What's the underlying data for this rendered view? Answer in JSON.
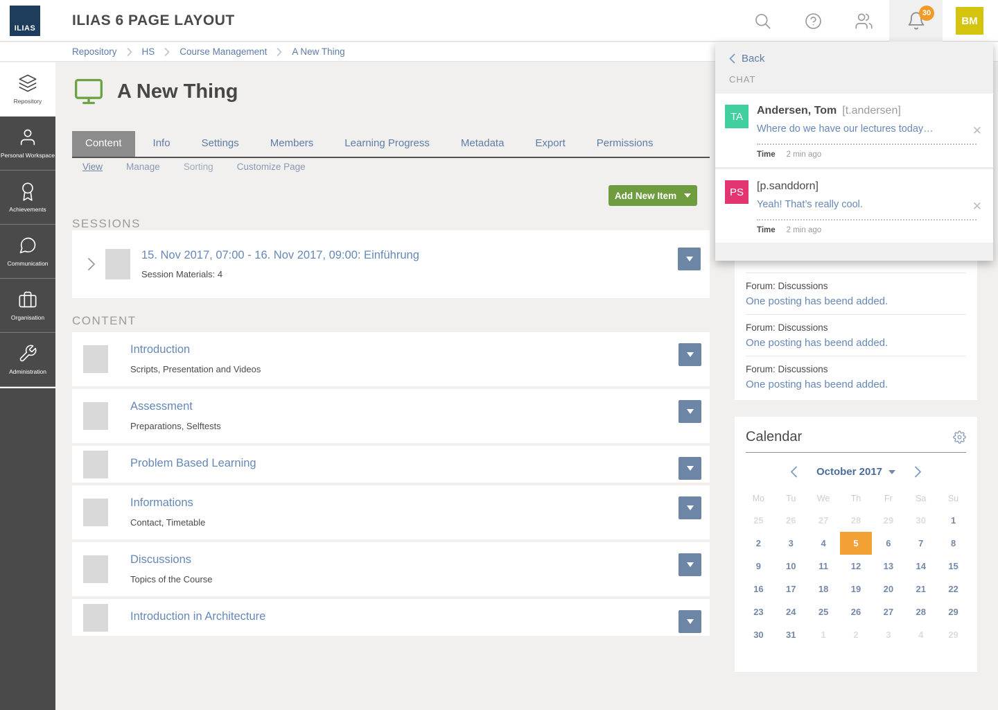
{
  "header": {
    "logo_text": "ILIAS",
    "title": "ILIAS 6 PAGE LAYOUT",
    "notification_count": "30",
    "avatar_initials": "BM"
  },
  "breadcrumb": {
    "items": [
      {
        "label": "Repository"
      },
      {
        "label": "HS"
      },
      {
        "label": "Course Management"
      },
      {
        "label": "A New Thing"
      }
    ]
  },
  "sidebar": {
    "items": [
      {
        "label": "Repository"
      },
      {
        "label": "Personal Workspace"
      },
      {
        "label": "Achievements"
      },
      {
        "label": "Communication"
      },
      {
        "label": "Organisation"
      },
      {
        "label": "Administration"
      }
    ]
  },
  "page": {
    "title": "A New Thing",
    "tabs": [
      {
        "label": "Content",
        "state": "active"
      },
      {
        "label": "Info",
        "state": ""
      },
      {
        "label": "Settings",
        "state": ""
      },
      {
        "label": "Members",
        "state": ""
      },
      {
        "label": "Learning Progress",
        "state": ""
      },
      {
        "label": "Metadata",
        "state": ""
      },
      {
        "label": "Export",
        "state": ""
      },
      {
        "label": "Permissions",
        "state": ""
      }
    ],
    "subtabs": [
      {
        "label": "View",
        "state": "active"
      },
      {
        "label": "Manage",
        "state": ""
      },
      {
        "label": "Sorting",
        "state": "muted"
      },
      {
        "label": "Customize Page",
        "state": ""
      }
    ],
    "add_button_label": "Add New Item"
  },
  "sessions": {
    "heading": "SESSIONS",
    "items": [
      {
        "title": "15. Nov 2017, 07:00 - 16. Nov 2017, 09:00: Einführung",
        "materials": "Session Materials: 4"
      }
    ]
  },
  "content": {
    "heading": "CONTENT",
    "items": [
      {
        "title": "Introduction",
        "description": "Scripts, Presentation and Videos"
      },
      {
        "title": "Assessment",
        "description": "Preparations, Selftests"
      },
      {
        "title": "Problem Based Learning",
        "description": ""
      },
      {
        "title": "Informations",
        "description": "Contact, Timetable"
      },
      {
        "title": "Discussions",
        "description": "Topics of the Course"
      },
      {
        "title": "Introduction in Architecture",
        "description": ""
      }
    ]
  },
  "chat": {
    "back_label": "Back",
    "heading": "CHAT",
    "messages": [
      {
        "initials": "TA",
        "avatar_color": "#40CF9F",
        "name": "Andersen, Tom",
        "handle": "[t.andersen]",
        "message": "Where do we have our lectures today…",
        "time_label": "Time",
        "time_value": "2 min ago"
      },
      {
        "initials": "PS",
        "avatar_color": "#E23572",
        "name": "[p.sanddorn]",
        "handle": "",
        "message": "Yeah! That’s really cool.",
        "time_label": "Time",
        "time_value": "2 min ago"
      }
    ]
  },
  "forum_feed": {
    "items": [
      {
        "title": "Forum: Discussions",
        "link": "One posting has beend added."
      },
      {
        "title": "Forum: Discussions",
        "link": "One posting has beend added."
      },
      {
        "title": "Forum: Discussions",
        "link": "One posting has beend added."
      }
    ]
  },
  "calendar": {
    "title": "Calendar",
    "month_label": "October 2017",
    "weekdays": [
      "Mo",
      "Tu",
      "We",
      "Th",
      "Fr",
      "Sa",
      "Su"
    ],
    "days": [
      {
        "v": "25",
        "s": "muted"
      },
      {
        "v": "26",
        "s": "muted"
      },
      {
        "v": "27",
        "s": "muted"
      },
      {
        "v": "28",
        "s": "muted"
      },
      {
        "v": "29",
        "s": "muted"
      },
      {
        "v": "30",
        "s": "muted"
      },
      {
        "v": "1",
        "s": ""
      },
      {
        "v": "2",
        "s": ""
      },
      {
        "v": "3",
        "s": ""
      },
      {
        "v": "4",
        "s": ""
      },
      {
        "v": "5",
        "s": "sel"
      },
      {
        "v": "6",
        "s": ""
      },
      {
        "v": "7",
        "s": ""
      },
      {
        "v": "8",
        "s": ""
      },
      {
        "v": "9",
        "s": ""
      },
      {
        "v": "10",
        "s": ""
      },
      {
        "v": "11",
        "s": ""
      },
      {
        "v": "12",
        "s": ""
      },
      {
        "v": "13",
        "s": ""
      },
      {
        "v": "14",
        "s": ""
      },
      {
        "v": "15",
        "s": ""
      },
      {
        "v": "16",
        "s": ""
      },
      {
        "v": "17",
        "s": ""
      },
      {
        "v": "18",
        "s": ""
      },
      {
        "v": "19",
        "s": ""
      },
      {
        "v": "20",
        "s": ""
      },
      {
        "v": "21",
        "s": ""
      },
      {
        "v": "22",
        "s": ""
      },
      {
        "v": "23",
        "s": ""
      },
      {
        "v": "24",
        "s": ""
      },
      {
        "v": "25",
        "s": ""
      },
      {
        "v": "26",
        "s": ""
      },
      {
        "v": "27",
        "s": ""
      },
      {
        "v": "28",
        "s": ""
      },
      {
        "v": "29",
        "s": ""
      },
      {
        "v": "30",
        "s": ""
      },
      {
        "v": "31",
        "s": ""
      },
      {
        "v": "1",
        "s": "muted"
      },
      {
        "v": "2",
        "s": "muted"
      },
      {
        "v": "3",
        "s": "muted"
      },
      {
        "v": "4",
        "s": "muted"
      },
      {
        "v": "29",
        "s": "muted"
      }
    ]
  },
  "colors": {
    "brand_navy": "#1E3C5C",
    "sidebar_dark": "#4A4A4A",
    "link_blue": "#6588B8",
    "nav_blue": "#5E7CA6",
    "active_tab_gray": "#8C8C8C",
    "accent_green": "#6E9C3E",
    "dropdown_blue_gray": "#6E86A6",
    "badge_orange": "#F29A28",
    "calendar_selected_orange": "#F2A235",
    "avatar_yellow": "#D4C40E",
    "avatar_teal": "#40CF9F",
    "avatar_pink": "#E23572"
  }
}
